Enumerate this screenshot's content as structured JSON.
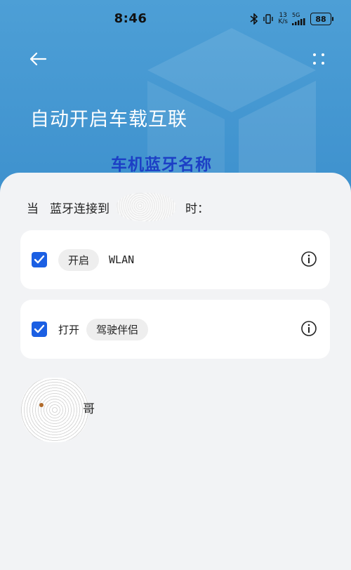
{
  "status_bar": {
    "time": "8:46",
    "speed_value": "13",
    "speed_unit": "K/s",
    "network": "5G",
    "battery": "88"
  },
  "header": {
    "title": "自动开启车载互联",
    "overlay_label": "车机蓝牙名称"
  },
  "condition": {
    "prefix": "当",
    "connect_text": "蓝牙连接到",
    "suffix": "时："
  },
  "actions": [
    {
      "checked": true,
      "chip_label": "开启",
      "target": "WLAN"
    },
    {
      "checked": true,
      "verb": "打开",
      "chip_label": "驾驶伴侣"
    }
  ],
  "contact": {
    "suffix": "哥"
  },
  "colors": {
    "header_bg": "#4a9cd4",
    "sheet_bg": "#f2f3f5",
    "accent": "#1b5fe3",
    "overlay_text": "#1c3fc5"
  },
  "icons": {
    "back": "arrow-left-icon",
    "more": "more-icon",
    "info": "info-icon",
    "check": "check-icon"
  }
}
